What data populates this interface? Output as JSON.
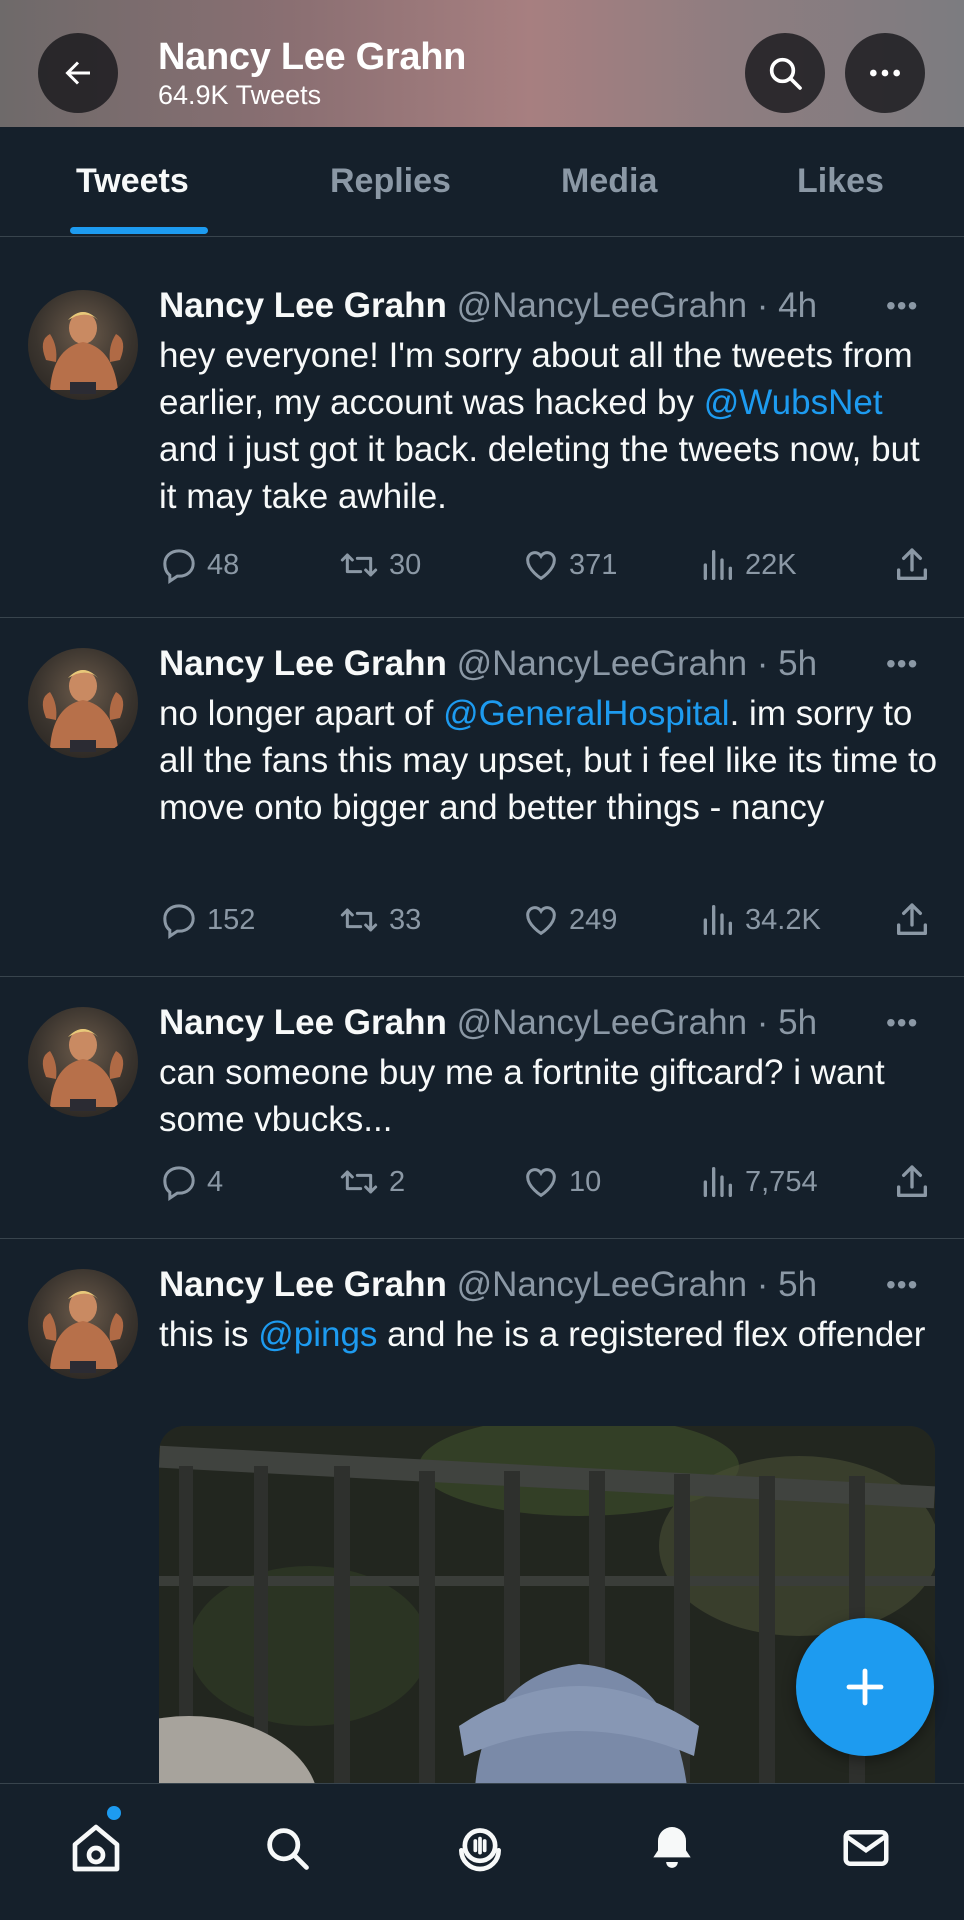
{
  "header": {
    "title": "Nancy Lee Grahn",
    "subtitle": "64.9K Tweets",
    "back_icon": "back-arrow-icon",
    "search_icon": "search-icon",
    "more_icon": "more-icon"
  },
  "tabs": [
    {
      "label": "Tweets",
      "active": true
    },
    {
      "label": "Replies",
      "active": false
    },
    {
      "label": "Media",
      "active": false
    },
    {
      "label": "Likes",
      "active": false
    }
  ],
  "tweets": [
    {
      "name": "Nancy Lee Grahn",
      "handle": "@NancyLeeGrahn",
      "time": "· 4h",
      "text_parts": [
        "hey everyone! I'm sorry about all the tweets from earlier, my account was hacked by ",
        "@WubsNet",
        " and i just got it back. deleting the tweets now, but it may take awhile."
      ],
      "replies": "48",
      "retweets": "30",
      "likes": "371",
      "views": "22K"
    },
    {
      "name": "Nancy Lee Grahn",
      "handle": "@NancyLeeGrahn",
      "time": "· 5h",
      "text_parts": [
        "no longer apart of ",
        "@GeneralHospital",
        ". im sorry to all the fans this may upset, but i feel like its time to move onto bigger and better things - nancy"
      ],
      "replies": "152",
      "retweets": "33",
      "likes": "249",
      "views": "34.2K"
    },
    {
      "name": "Nancy Lee Grahn",
      "handle": "@NancyLeeGrahn",
      "time": "· 5h",
      "text_parts": [
        "can someone buy me a fortnite giftcard? i want some vbucks..."
      ],
      "replies": "4",
      "retweets": "2",
      "likes": "10",
      "views": "7,754"
    },
    {
      "name": "Nancy Lee Grahn",
      "handle": "@NancyLeeGrahn",
      "time": "· 5h",
      "text_parts": [
        "this is ",
        "@pings",
        " and he is a registered flex offender"
      ]
    }
  ],
  "more_label": "•••",
  "nav": {
    "home_icon": "home-icon",
    "search_icon": "search-icon",
    "spaces_icon": "spaces-icon",
    "notifications_icon": "bell-icon",
    "messages_icon": "mail-icon"
  },
  "colors": {
    "background": "#15202b",
    "accent": "#1d9bf0",
    "muted": "#8b98a5",
    "divider": "#38444d"
  }
}
